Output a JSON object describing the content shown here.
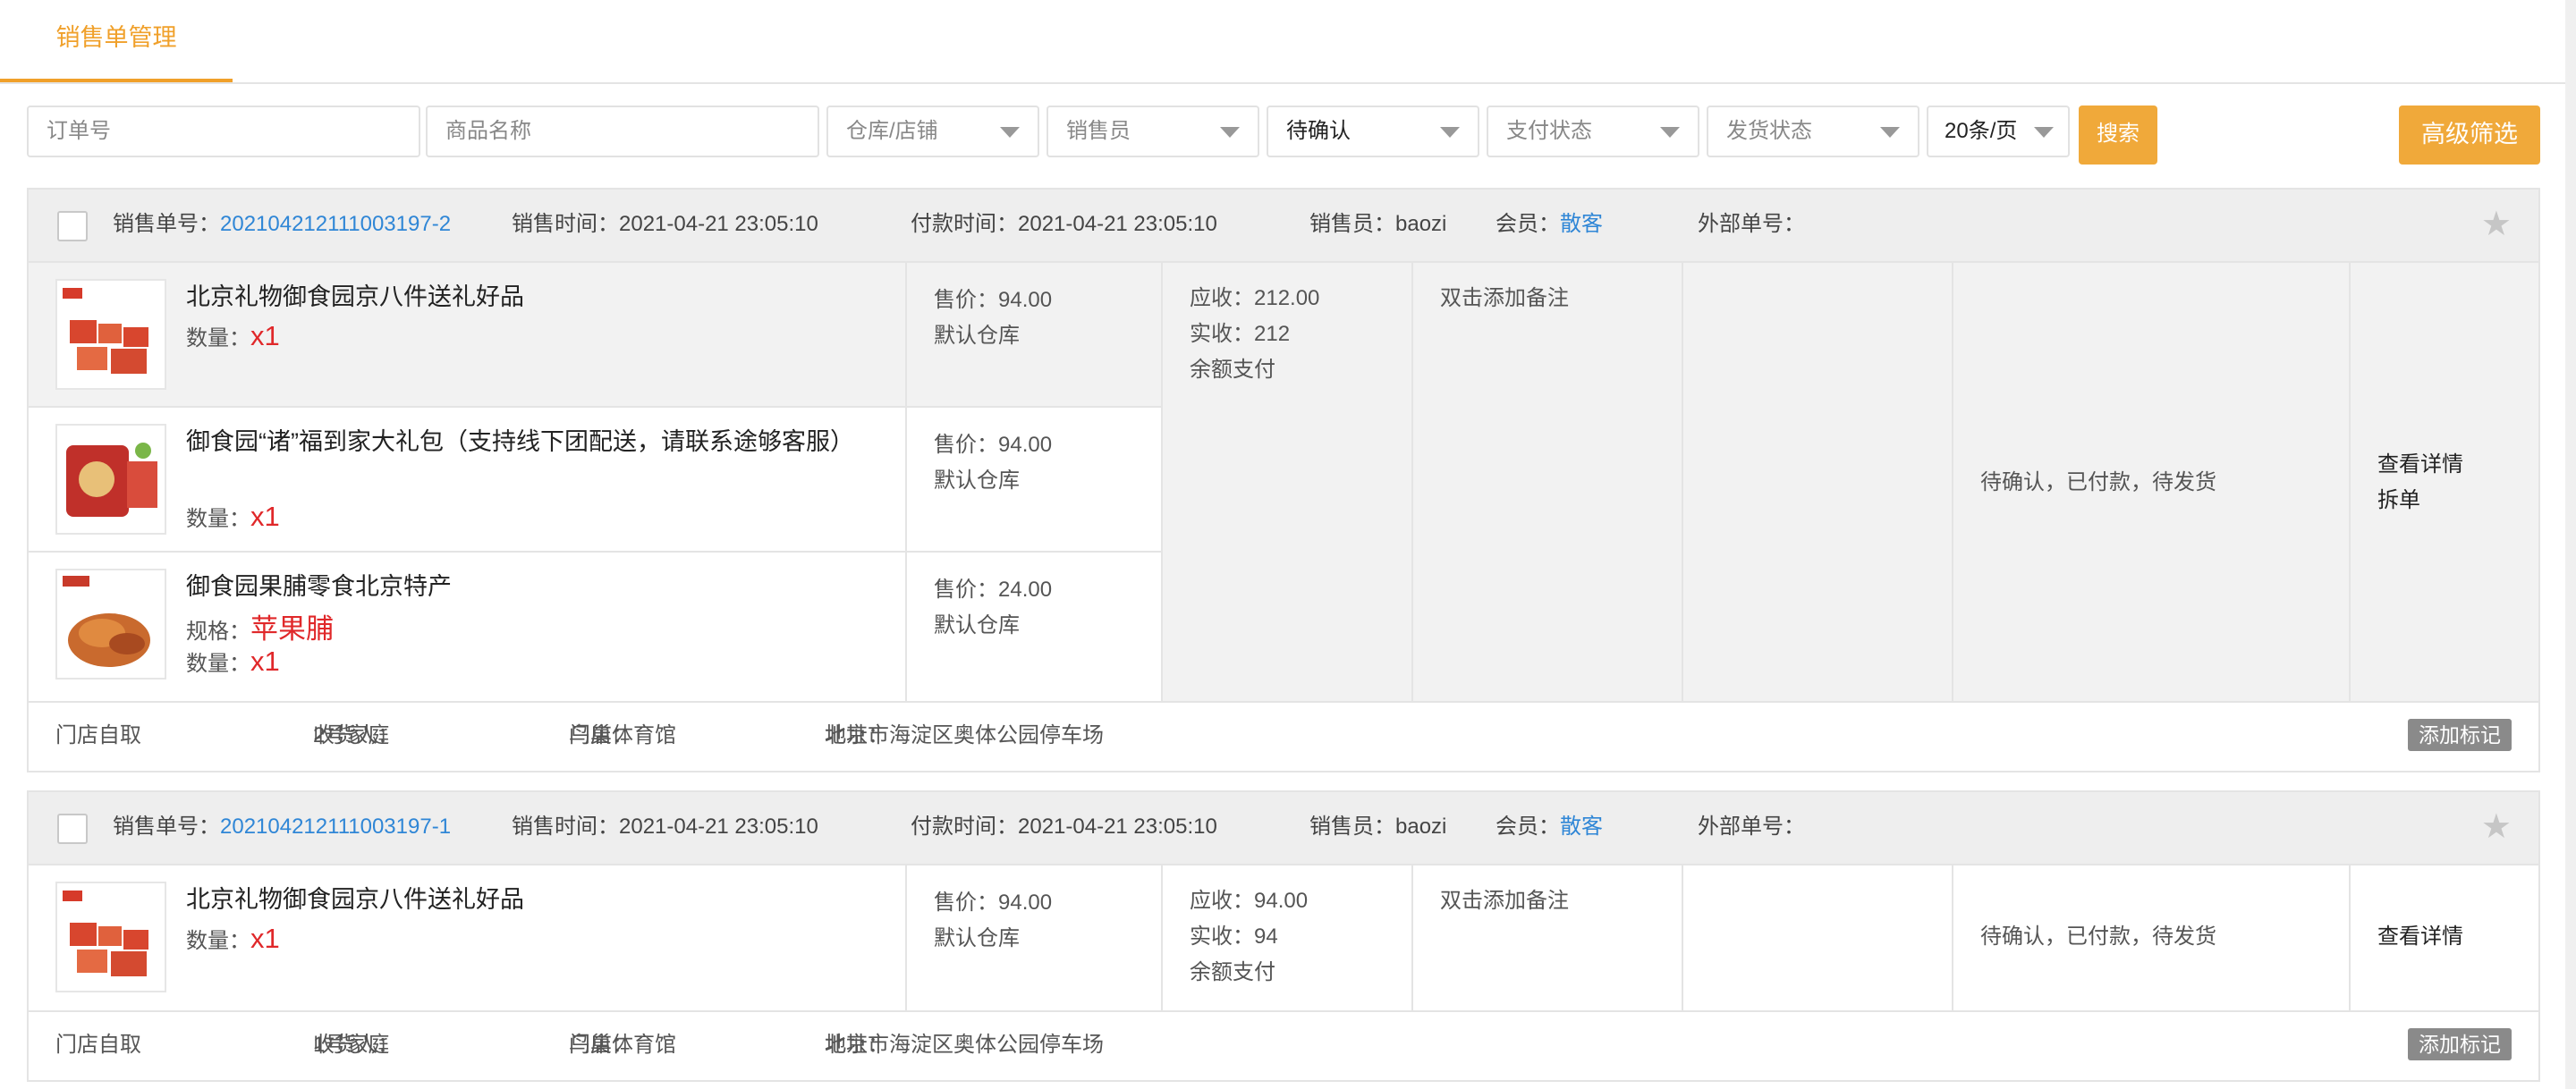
{
  "tab": {
    "label": "销售单管理"
  },
  "filters": {
    "order_no_placeholder": "订单号",
    "product_placeholder": "商品名称",
    "warehouse": "仓库/店铺",
    "salesperson": "销售员",
    "status": "待确认",
    "pay_status": "支付状态",
    "ship_status": "发货状态",
    "page_size": "20条/页",
    "search_label": "搜索",
    "advanced_label": "高级筛选"
  },
  "labels": {
    "order_no": "销售单号：",
    "sale_time": "销售时间：",
    "pay_time": "付款时间：",
    "salesperson": "销售员：",
    "member": "会员：",
    "external_no": "外部单号：",
    "price": "售价：",
    "qty": "数量：",
    "spec": "规格：",
    "receivable": "应收：",
    "received": "实收：",
    "add_remark": "双击添加备注",
    "view_detail": "查看详情",
    "split": "拆单",
    "receiver": "收货人：",
    "store": "门店：",
    "address": "地址：",
    "add_tag": "添加标记"
  },
  "orders": [
    {
      "order_no": "202104212111003197-2",
      "sale_time": "2021-04-21 23:05:10",
      "pay_time": "2021-04-21 23:05:10",
      "salesperson": "baozi",
      "member": "散客",
      "external_no": "",
      "products": [
        {
          "name": "北京礼物御食园京八件送礼好品",
          "qty": "x1",
          "spec": "",
          "price": "94.00",
          "warehouse": "默认仓库"
        },
        {
          "name": "御食园“诸”福到家大礼包（支持线下团配送，请联系途够客服）",
          "qty": "x1",
          "spec": "",
          "price": "94.00",
          "warehouse": "默认仓库"
        },
        {
          "name": "御食园果脯零食北京特产",
          "qty": "x1",
          "spec": "苹果脯",
          "price": "24.00",
          "warehouse": "默认仓库"
        }
      ],
      "receivable": "212.00",
      "received": "212",
      "pay_method": "余额支付",
      "status_text": "待确认，已付款，待发货",
      "delivery": "门店自取",
      "receiver": "2号家庭",
      "store": "鸟巢体育馆",
      "address": "北京市海淀区奥体公园停车场"
    },
    {
      "order_no": "202104212111003197-1",
      "sale_time": "2021-04-21 23:05:10",
      "pay_time": "2021-04-21 23:05:10",
      "salesperson": "baozi",
      "member": "散客",
      "external_no": "",
      "products": [
        {
          "name": "北京礼物御食园京八件送礼好品",
          "qty": "x1",
          "spec": "",
          "price": "94.00",
          "warehouse": "默认仓库"
        }
      ],
      "receivable": "94.00",
      "received": "94",
      "pay_method": "余额支付",
      "status_text": "待确认，已付款，待发货",
      "delivery": "门店自取",
      "receiver": "1号家庭",
      "store": "鸟巢体育馆",
      "address": "北京市海淀区奥体公园停车场"
    }
  ],
  "colors": {
    "accent": "#f0a93a",
    "link": "#2f86d6",
    "red": "#e0282a"
  }
}
